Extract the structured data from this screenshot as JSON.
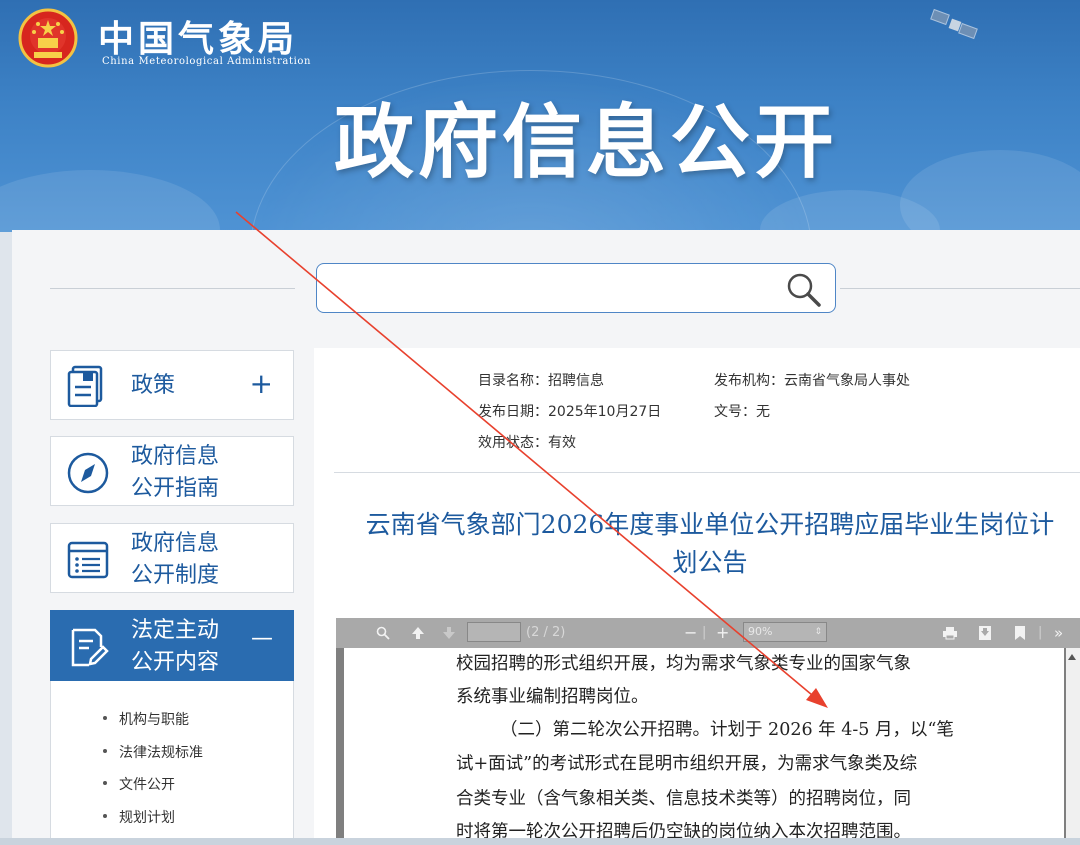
{
  "header": {
    "org_name_cn": "中国气象局",
    "org_name_en": "China Meteorological Administration",
    "banner_title": "政府信息公开"
  },
  "search": {
    "value": "",
    "placeholder": ""
  },
  "sidebar": {
    "items": [
      {
        "label_line1": "政策",
        "label_line2": "",
        "sign": "+",
        "icon": "document-stack-icon"
      },
      {
        "label_line1": "政府信息",
        "label_line2": "公开指南",
        "sign": "",
        "icon": "compass-icon"
      },
      {
        "label_line1": "政府信息",
        "label_line2": "公开制度",
        "sign": "",
        "icon": "list-doc-icon"
      },
      {
        "label_line1": "法定主动",
        "label_line2": "公开内容",
        "sign": "—",
        "icon": "edit-doc-icon",
        "active": true
      }
    ],
    "subitems": [
      "机构与职能",
      "法律法规标准",
      "文件公开",
      "规划计划"
    ]
  },
  "meta": {
    "catalog": "目录名称：招聘信息",
    "publisher": "发布机构：云南省气象局人事处",
    "date": "发布日期：2025年10月27日",
    "doc_no": "文号：无",
    "status": "效用状态：有效"
  },
  "document": {
    "title_line1": "云南省气象部门2026年度事业单位公开招聘应届毕业生岗位计",
    "title_line2": "划公告"
  },
  "pdf_toolbar": {
    "page_count": "(2 / 2)",
    "zoom": "90%"
  },
  "pdf_text": {
    "lines": [
      "校园招聘的形式组织开展，均为需求气象类专业的国家气象",
      "系统事业编制招聘岗位。",
      "（二）第二轮次公开招聘。计划于 2026 年 4-5 月，以“笔",
      "试+面试”的考试形式在昆明市组织开展，为需求气象类及综",
      "合类专业（含气象相关类、信息技术类等）的招聘岗位，同",
      "时将第一轮次公开招聘后仍空缺的岗位纳入本次招聘范围。"
    ]
  },
  "colors": {
    "banner": "#3d82c6",
    "accent": "#1d5a9e",
    "active_sidebar": "#2a6cb0",
    "annotation_arrow": "#e8412e"
  }
}
